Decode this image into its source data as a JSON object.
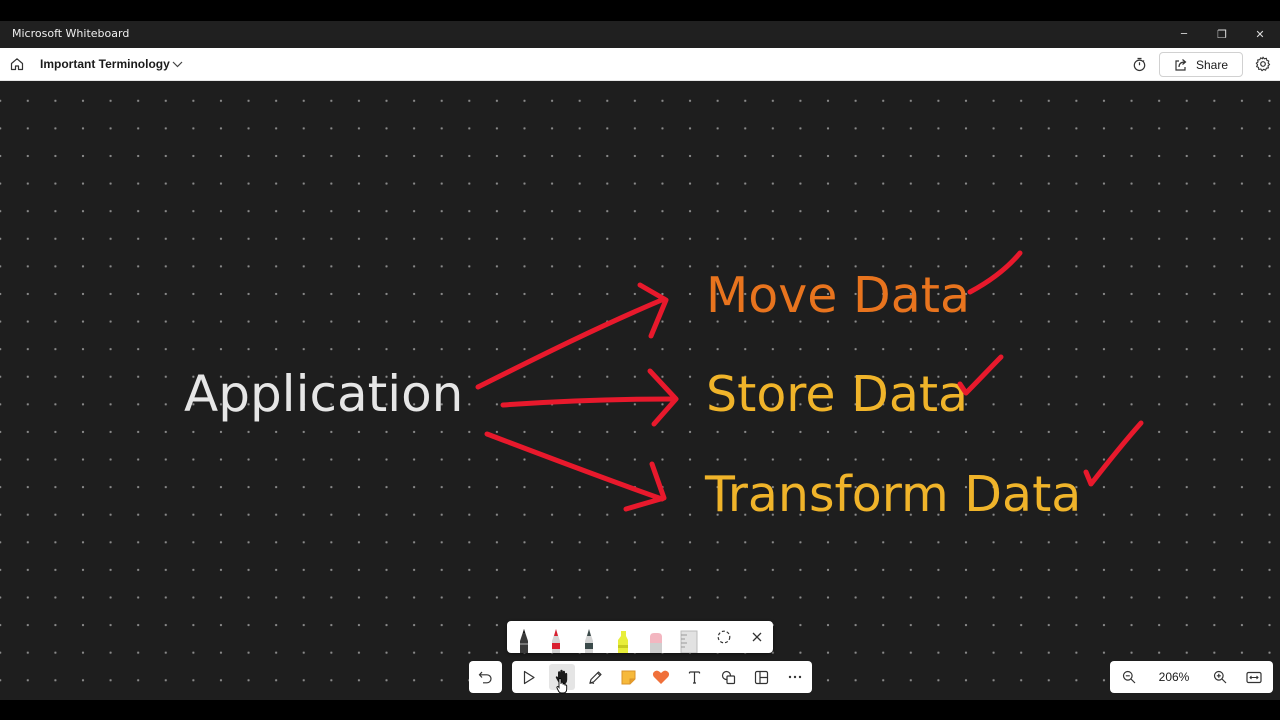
{
  "window": {
    "title": "Microsoft Whiteboard",
    "minimize_glyph": "─",
    "restore_glyph": "❐",
    "close_glyph": "✕"
  },
  "header": {
    "board_title": "Important Terminology",
    "share_label": "Share"
  },
  "canvas": {
    "texts": {
      "application": "Application",
      "move": "Move Data",
      "store": "Store Data",
      "transform": "Transform Data"
    },
    "colors": {
      "background": "#1e1e1e",
      "application": "#e6e6e6",
      "move": "#e8741e",
      "store": "#f0b42a",
      "transform": "#f0b42a",
      "ink": "#e8192c"
    }
  },
  "pen_tray": {
    "pens": [
      "black-pen",
      "red-pen",
      "dark-gray-pen",
      "yellow-highlighter",
      "pink-eraser",
      "ruler"
    ],
    "extras": [
      "lasso-select-icon",
      "close-icon"
    ]
  },
  "toolbar": {
    "tools": [
      "select-icon",
      "hand-pan-icon",
      "pen-icon",
      "sticky-note-icon",
      "reactions-icon",
      "text-icon",
      "shapes-icon",
      "templates-icon",
      "more-icon"
    ],
    "active_tool": "hand-pan-icon"
  },
  "zoom": {
    "level": "206%"
  }
}
